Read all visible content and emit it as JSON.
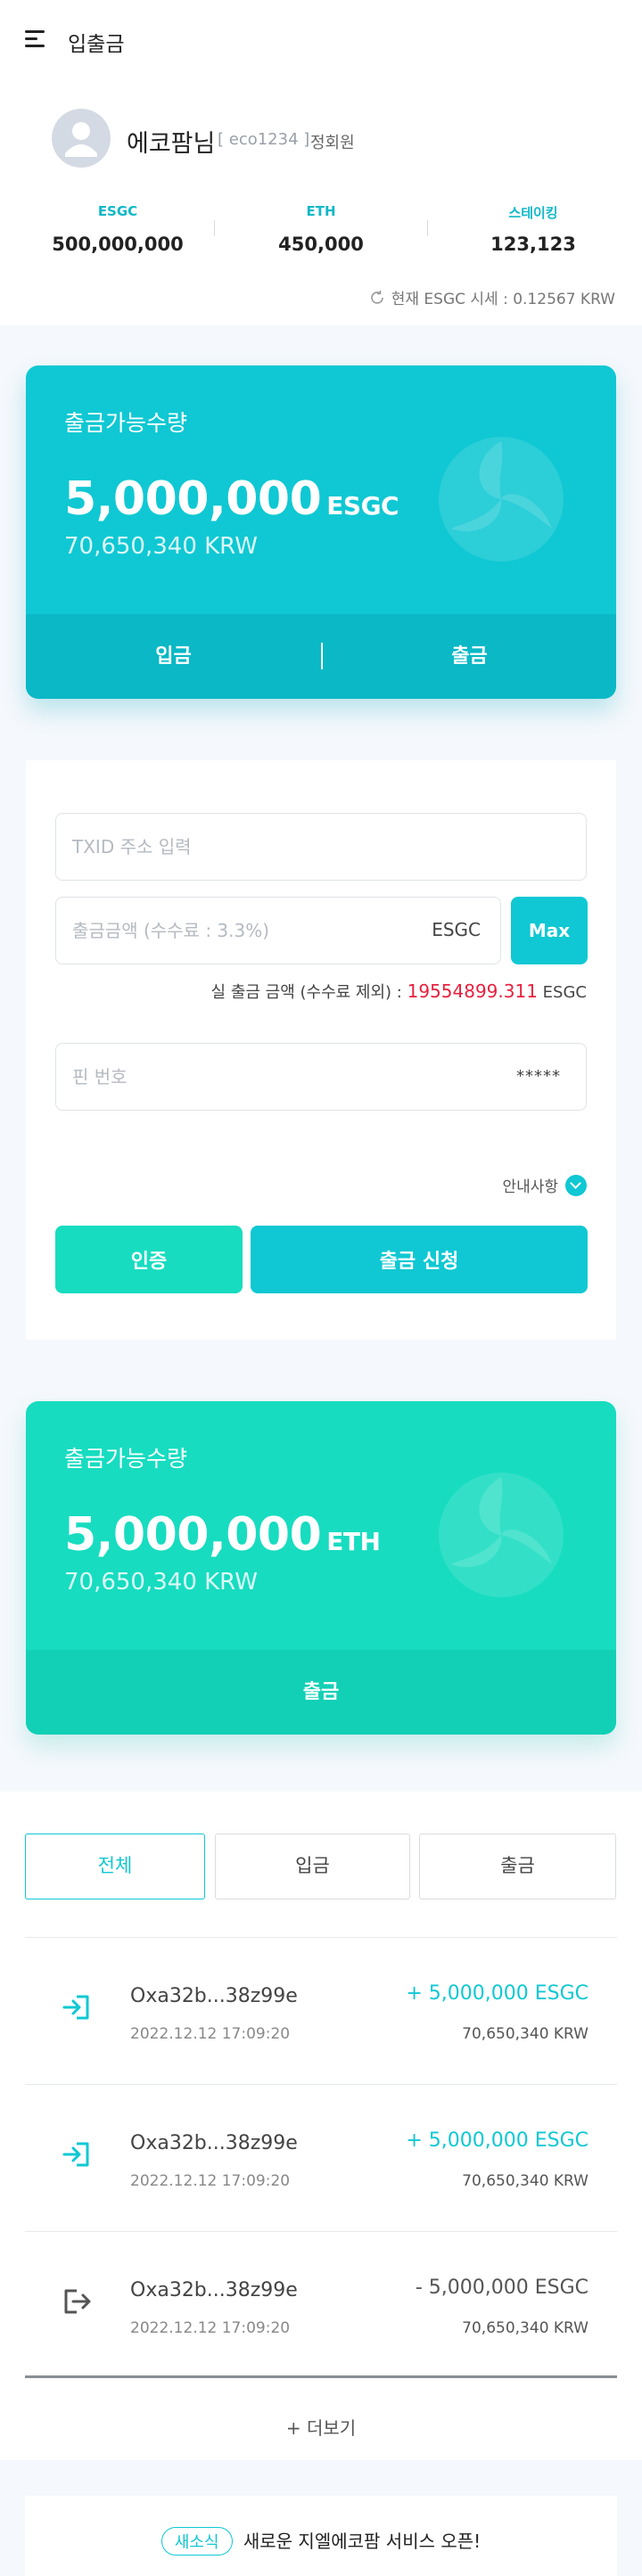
{
  "header": {
    "title": "입출금"
  },
  "profile": {
    "name": "에코팜님",
    "id": "[ eco1234 ]",
    "grade": "정회원"
  },
  "stats": [
    {
      "label": "ESGC",
      "value": "500,000,000"
    },
    {
      "label": "ETH",
      "value": "450,000"
    },
    {
      "label": "스테이킹",
      "value": "123,123"
    }
  ],
  "rate": {
    "text": "현재 ESGC 시세 : 0.12567 KRW"
  },
  "esgc_card": {
    "title": "출금가능수량",
    "amount": "5,000,000",
    "unit": "ESGC",
    "krw": "70,650,340 KRW",
    "deposit_label": "입금",
    "withdraw_label": "출금"
  },
  "withdraw_form": {
    "txid_placeholder": "TXID 주소 입력",
    "amount_placeholder": "출금금액 (수수료 : 3.3%)",
    "amount_unit": "ESGC",
    "max_label": "Max",
    "actual_label": "실 출금 금액 (수수료 제외) :",
    "actual_value": "19554899.311",
    "actual_unit": "ESGC",
    "pin_placeholder": "핀 번호",
    "pin_mask": "*****",
    "notice_label": "안내사항",
    "auth_label": "인증",
    "apply_label": "출금 신청"
  },
  "eth_card": {
    "title": "출금가능수량",
    "amount": "5,000,000",
    "unit": "ETH",
    "krw": "70,650,340 KRW",
    "withdraw_label": "출금"
  },
  "history": {
    "tabs": [
      "전체",
      "입금",
      "출금"
    ],
    "active_tab": 0,
    "items": [
      {
        "type": "deposit",
        "address": "Oxa32b...38z99e",
        "date": "2022.12.12 17:09:20",
        "amount": "+ 5,000,000 ESGC",
        "krw": "70,650,340 KRW"
      },
      {
        "type": "deposit",
        "address": "Oxa32b...38z99e",
        "date": "2022.12.12 17:09:20",
        "amount": "+ 5,000,000 ESGC",
        "krw": "70,650,340 KRW"
      },
      {
        "type": "withdraw",
        "address": "Oxa32b...38z99e",
        "date": "2022.12.12 17:09:20",
        "amount": "- 5,000,000 ESGC",
        "krw": "70,650,340 KRW"
      }
    ],
    "more_label": "+ 더보기"
  },
  "news": {
    "badge": "새소식",
    "text": "새로운 지엘에코팜 서비스 오픈!"
  },
  "colors": {
    "cyan": "#0fc8d3",
    "mint": "#17dcc0",
    "red": "#e8203e"
  }
}
